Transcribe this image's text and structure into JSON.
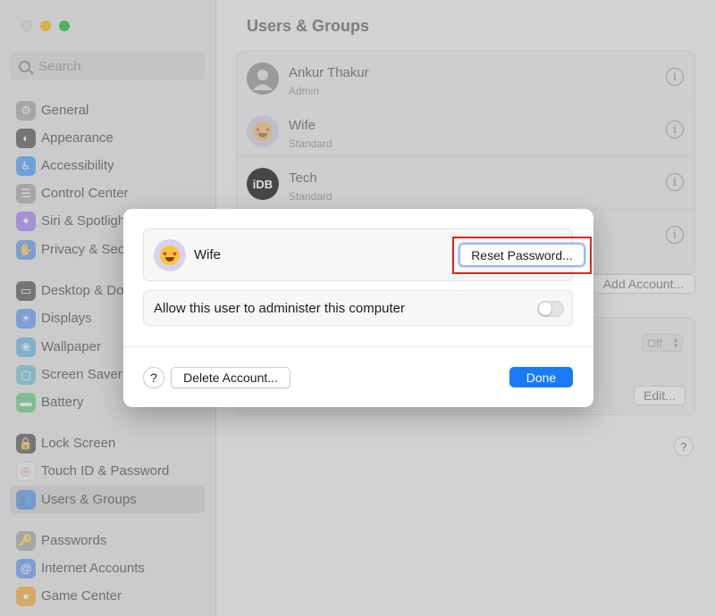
{
  "window": {
    "title": "Users & Groups",
    "colors": {
      "close": "#dcdcdc",
      "minimize": "#f6be3b",
      "maximize": "#3dc44f"
    }
  },
  "sidebar": {
    "search_placeholder": "Search",
    "items": [
      {
        "label": "General",
        "icon": "gear-icon",
        "color": "#8e8e93"
      },
      {
        "label": "Appearance",
        "icon": "appearance-icon",
        "color": "#1c1c1e"
      },
      {
        "label": "Accessibility",
        "icon": "accessibility-icon",
        "color": "#0a84ff"
      },
      {
        "label": "Control Center",
        "icon": "control-center-icon",
        "color": "#8e8e93"
      },
      {
        "label": "Siri & Spotlight",
        "icon": "siri-icon",
        "color": "#8a5cf6"
      },
      {
        "label": "Privacy & Security",
        "icon": "hand-icon",
        "color": "#2f7cf6"
      },
      {
        "label": "Desktop & Dock",
        "icon": "desktop-dock-icon",
        "color": "#1c1c1e"
      },
      {
        "label": "Displays",
        "icon": "displays-icon",
        "color": "#2f7cf6"
      },
      {
        "label": "Wallpaper",
        "icon": "wallpaper-icon",
        "color": "#35a7e8"
      },
      {
        "label": "Screen Saver",
        "icon": "screen-saver-icon",
        "color": "#4fb6d8"
      },
      {
        "label": "Battery",
        "icon": "battery-icon",
        "color": "#34c759"
      },
      {
        "label": "Lock Screen",
        "icon": "lock-icon",
        "color": "#1c1c1e"
      },
      {
        "label": "Touch ID & Password",
        "icon": "fingerprint-icon",
        "color": "#f2f2f2"
      },
      {
        "label": "Users & Groups",
        "icon": "users-icon",
        "color": "#2f7cf6",
        "selected": true
      },
      {
        "label": "Passwords",
        "icon": "key-icon",
        "color": "#8e8e93"
      },
      {
        "label": "Internet Accounts",
        "icon": "at-icon",
        "color": "#2f7cf6"
      },
      {
        "label": "Game Center",
        "icon": "game-center-icon",
        "color": "#ff9500"
      }
    ]
  },
  "main": {
    "title": "Users & Groups",
    "users": [
      {
        "name": "Ankur Thakur",
        "role": "Admin",
        "avatar": "photo",
        "avatar_color": "#9b9b9b"
      },
      {
        "name": "Wife",
        "role": "Standard",
        "avatar": "emoji",
        "avatar_color": "#d6d0e6"
      },
      {
        "name": "Tech",
        "role": "Standard",
        "avatar": "iDB",
        "avatar_color": "#3a3a3a"
      }
    ],
    "add_account_label": "Add Account...",
    "off_value": "Off",
    "edit_label": "Edit...",
    "help_label": "?"
  },
  "sheet": {
    "user_name": "Wife",
    "reset_password_label": "Reset Password...",
    "admin_toggle_label": "Allow this user to administer this computer",
    "admin_toggle_on": false,
    "help_label": "?",
    "delete_label": "Delete Account...",
    "done_label": "Done",
    "colors": {
      "done": "#1a7af8",
      "highlight": "#e3231e"
    }
  }
}
